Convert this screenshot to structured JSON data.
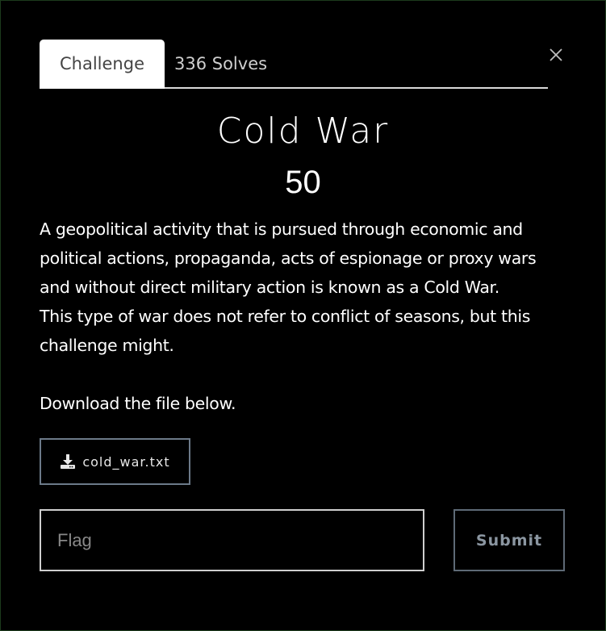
{
  "tabs": [
    {
      "label": "Challenge",
      "active": true
    },
    {
      "label": "336 Solves",
      "active": false
    }
  ],
  "challenge": {
    "name": "Cold War",
    "points": "50",
    "description_lines": [
      "A geopolitical activity that is pursued through economic and",
      "political actions, propaganda, acts of espionage or proxy wars",
      "and without direct military action is known as a Cold War.",
      "This type of war does not refer to conflict of seasons, but this",
      "challenge might."
    ],
    "download_note": "Download the file below."
  },
  "file": {
    "name": "cold_war.txt",
    "icon": "download-icon"
  },
  "flag_form": {
    "placeholder": "Flag",
    "submit_label": "Submit"
  },
  "colors": {
    "background": "#000000",
    "text": "#ffffff",
    "tab_active_bg": "#ffffff",
    "button_border": "#6c7a89"
  }
}
